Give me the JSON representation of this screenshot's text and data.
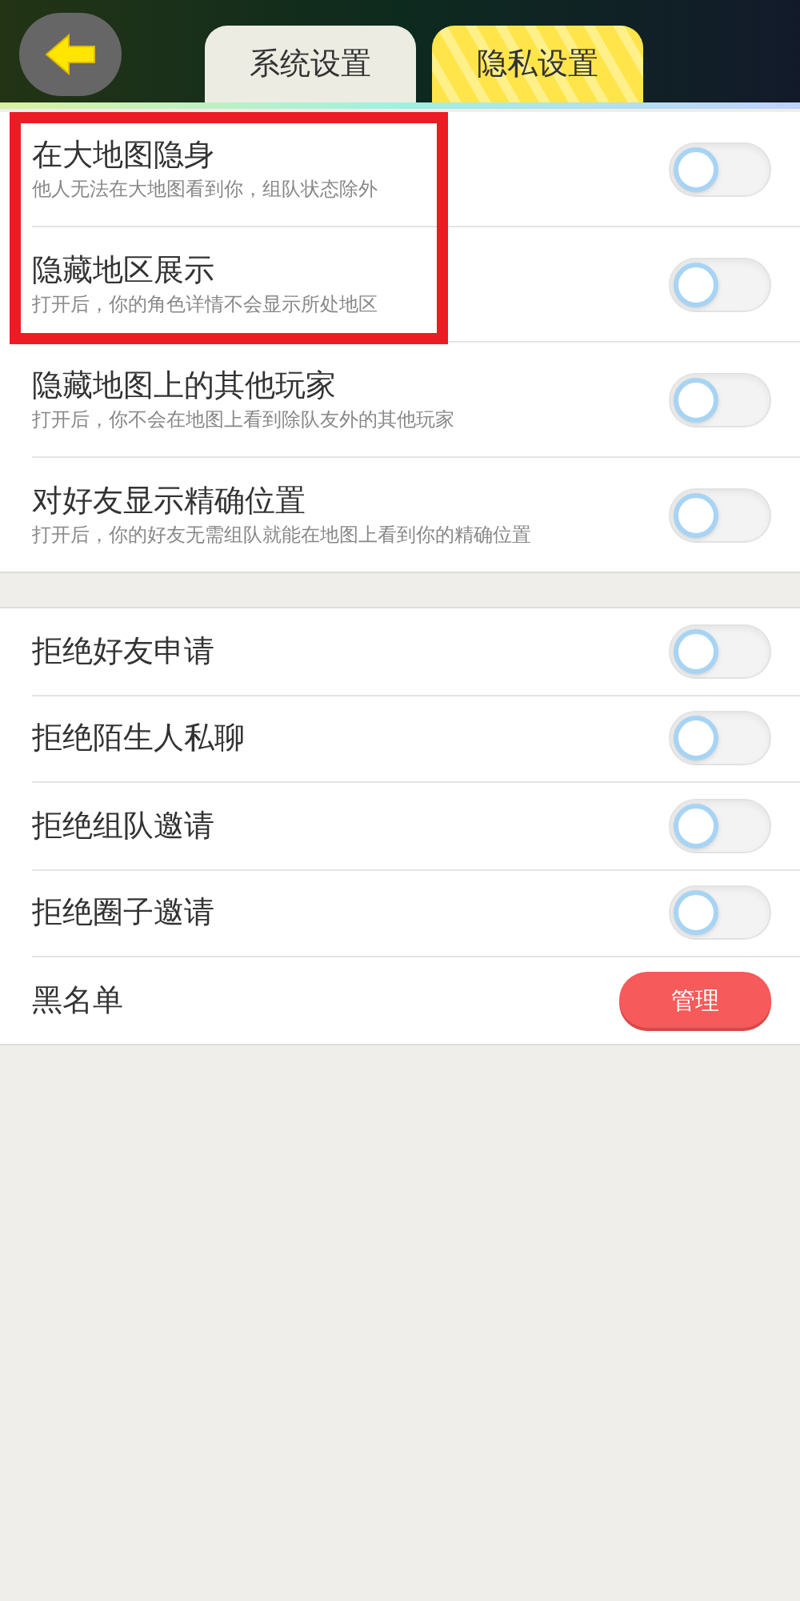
{
  "tabs": [
    {
      "label": "系统设置",
      "selected": false
    },
    {
      "label": "隐私设置",
      "selected": true
    }
  ],
  "sections": [
    {
      "items": [
        {
          "kind": "toggle",
          "title": "在大地图隐身",
          "subtitle": "他人无法在大地图看到你，组队状态除外",
          "on": false,
          "highlighted": true
        },
        {
          "kind": "toggle",
          "title": "隐藏地区展示",
          "subtitle": "打开后，你的角色详情不会显示所处地区",
          "on": false,
          "highlighted": true
        },
        {
          "kind": "toggle",
          "title": "隐藏地图上的其他玩家",
          "subtitle": "打开后，你不会在地图上看到除队友外的其他玩家",
          "on": false,
          "highlighted": false
        },
        {
          "kind": "toggle",
          "title": "对好友显示精确位置",
          "subtitle": "打开后，你的好友无需组队就能在地图上看到你的精确位置",
          "on": false,
          "highlighted": false
        }
      ]
    },
    {
      "items": [
        {
          "kind": "toggle",
          "title": "拒绝好友申请",
          "on": false
        },
        {
          "kind": "toggle",
          "title": "拒绝陌生人私聊",
          "on": false
        },
        {
          "kind": "toggle",
          "title": "拒绝组队邀请",
          "on": false
        },
        {
          "kind": "toggle",
          "title": "拒绝圈子邀请",
          "on": false
        },
        {
          "kind": "button",
          "title": "黑名单",
          "button": "管理"
        }
      ]
    }
  ]
}
